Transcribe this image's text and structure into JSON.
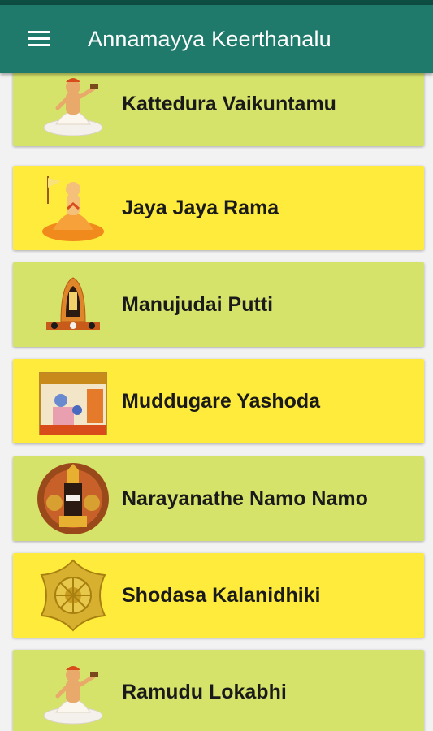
{
  "app": {
    "title": "Annamayya Keerthanalu"
  },
  "colors": {
    "appbar": "#1f7a6b",
    "card_green": "#d6e36a",
    "card_yellow": "#ffeb3b"
  },
  "items": [
    {
      "label": "Kattedura Vaikuntamu",
      "icon": "saint-annamayya-icon",
      "color": "#d6e36a"
    },
    {
      "label": "Jaya Jaya Rama",
      "icon": "saint-ramanuja-icon",
      "color": "#ffeb3b"
    },
    {
      "label": "Manujudai Putti",
      "icon": "temple-deity-icon",
      "color": "#d6e36a"
    },
    {
      "label": "Muddugare Yashoda",
      "icon": "yashoda-krishna-icon",
      "color": "#ffeb3b"
    },
    {
      "label": "Narayanathe Namo Namo",
      "icon": "venkateswara-icon",
      "color": "#d6e36a"
    },
    {
      "label": "Shodasa Kalanidhiki",
      "icon": "sudarshana-chakra-icon",
      "color": "#ffeb3b"
    },
    {
      "label": "Ramudu Lokabhi",
      "icon": "saint-annamayya-icon",
      "color": "#d6e36a"
    }
  ]
}
